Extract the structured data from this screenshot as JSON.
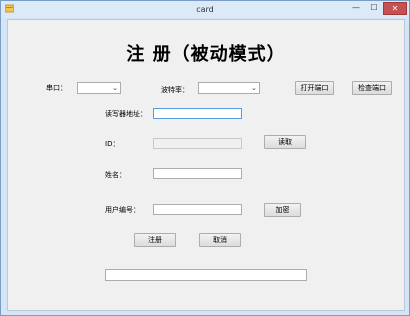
{
  "window": {
    "title": "card",
    "close_glyph": "✕",
    "minimize_glyph": "—",
    "maximize_glyph": "☐"
  },
  "form": {
    "heading": "注  册（被动模式）",
    "port_label": "串口：",
    "baud_label": "波特率：",
    "open_port_button": "打开端口",
    "check_port_button": "检查端口",
    "reader_addr_label": "读写器地址：",
    "reader_addr_value": "",
    "id_label": "ID：",
    "id_value": "",
    "read_button": "读取",
    "name_label": "姓名：",
    "name_value": "",
    "user_no_label": "用户编号：",
    "user_no_value": "",
    "encrypt_button": "加密",
    "register_button": "注册",
    "cancel_button": "取消",
    "status_value": ""
  }
}
